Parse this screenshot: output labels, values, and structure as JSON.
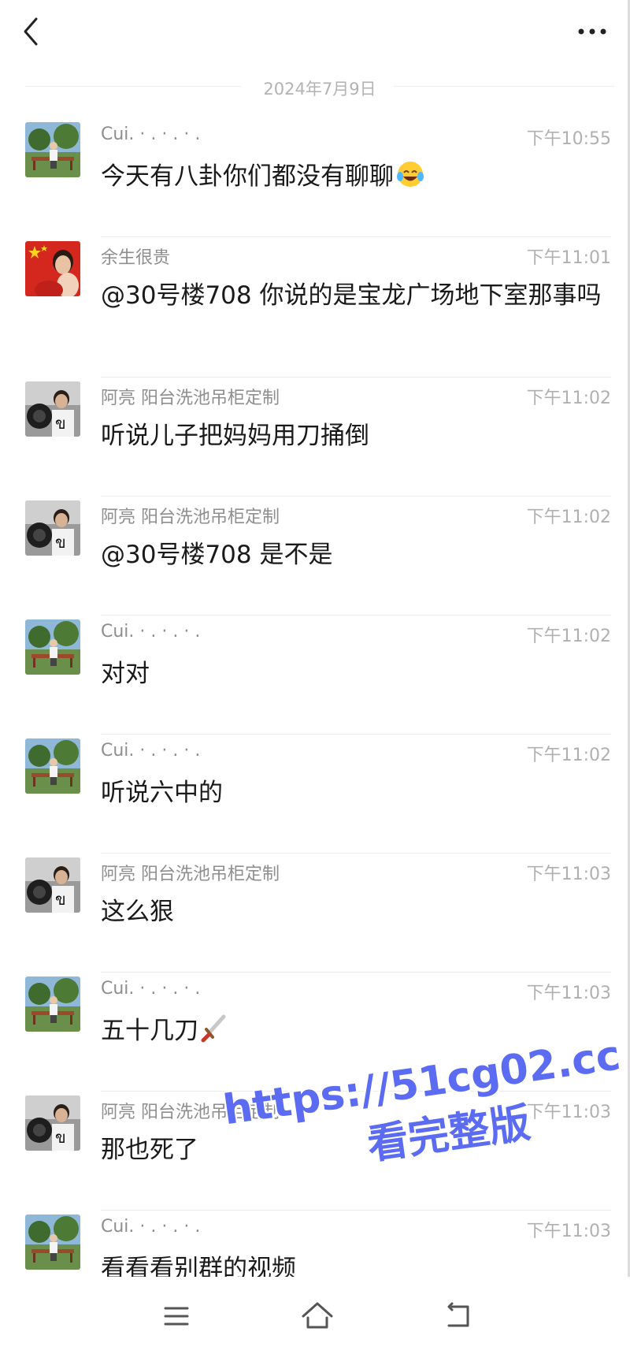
{
  "header": {
    "back_icon": "chevron-left-icon",
    "more_icon": "more-horizontal-icon"
  },
  "date_divider": "2024年7月9日",
  "colors": {
    "name_gray": "#8e8e8e",
    "time_gray": "#b0b0b0",
    "text_dark": "#1a1a1a",
    "watermark_blue": "#5b6cf2"
  },
  "messages": [
    {
      "sender": "Cui. · . · . · .",
      "time": "下午10:55",
      "text": "今天有八卦你们都没有聊聊",
      "emoji": "face-with-tears-of-joy",
      "avatar": "cui"
    },
    {
      "sender": "余生很贵",
      "time": "下午11:01",
      "text": "@30号楼708 你说的是宝龙广场地下室那事吗",
      "avatar": "yusheng"
    },
    {
      "sender": "阿亮 阳台洗池吊柜定制",
      "time": "下午11:02",
      "text": "听说儿子把妈妈用刀捅倒",
      "avatar": "aliang"
    },
    {
      "sender": "阿亮 阳台洗池吊柜定制",
      "time": "下午11:02",
      "text": "@30号楼708 是不是",
      "avatar": "aliang"
    },
    {
      "sender": "Cui. · . · . · .",
      "time": "下午11:02",
      "text": "对对",
      "avatar": "cui"
    },
    {
      "sender": "Cui. · . · . · .",
      "time": "下午11:02",
      "text": "听说六中的",
      "avatar": "cui"
    },
    {
      "sender": "阿亮 阳台洗池吊柜定制",
      "time": "下午11:03",
      "text": "这么狠",
      "avatar": "aliang"
    },
    {
      "sender": "Cui. · . · . · .",
      "time": "下午11:03",
      "text": "五十几刀",
      "emoji": "dagger",
      "avatar": "cui"
    },
    {
      "sender": "阿亮 阳台洗池吊柜定制",
      "time": "下午11:03",
      "text": "那也死了",
      "avatar": "aliang"
    },
    {
      "sender": "Cui. · . · . · .",
      "time": "下午11:03",
      "text": "看看看别群的视频",
      "avatar": "cui"
    }
  ],
  "watermark": {
    "line1": "https://51cg02.cc",
    "line2": "看完整版"
  },
  "nav": {
    "menu_icon": "menu-icon",
    "home_icon": "home-icon",
    "back_icon": "back-icon"
  }
}
